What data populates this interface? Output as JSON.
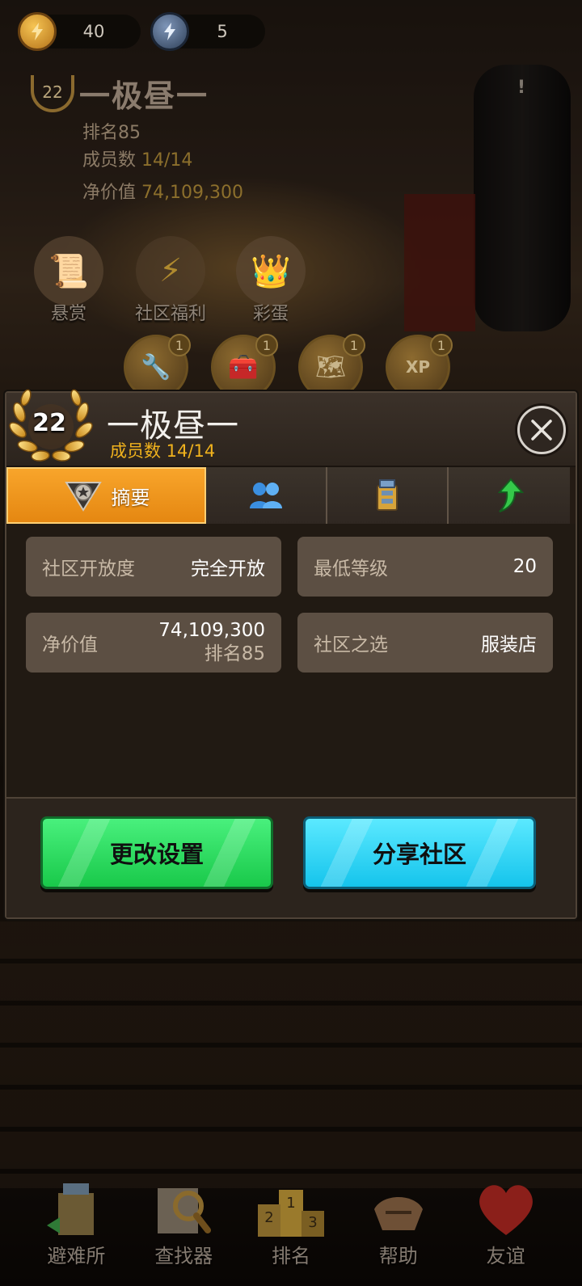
{
  "hud": {
    "coins": "40",
    "energy": "5"
  },
  "background_panel": {
    "level": "22",
    "name": "一极昼一",
    "rank_label": "排名",
    "rank_value": "85",
    "members_label": "成员数",
    "members_value": "14/14",
    "net_worth_label": "净价值",
    "net_worth_value": "74,109,300",
    "exclaim": "!"
  },
  "features": [
    {
      "label": "悬赏",
      "icon": "scroll-icon"
    },
    {
      "label": "社区福利",
      "icon": "lightning-icon"
    },
    {
      "label": "彩蛋",
      "icon": "crowned-egg-icon"
    }
  ],
  "rewards": [
    {
      "icon": "tools-icon",
      "badge": "1"
    },
    {
      "icon": "toolbox-icon",
      "badge": "1"
    },
    {
      "icon": "map-icon",
      "badge": "1"
    },
    {
      "icon": "xp-book-icon",
      "badge": "1"
    }
  ],
  "modal": {
    "level": "22",
    "title": "一极昼一",
    "members": "成员数 14/14",
    "tabs": [
      {
        "label": "摘要",
        "icon": "star-badge-icon",
        "active": true
      },
      {
        "label": "",
        "icon": "members-icon",
        "active": false
      },
      {
        "label": "",
        "icon": "shelter-tower-icon",
        "active": false
      },
      {
        "label": "",
        "icon": "upgrade-arrow-icon",
        "active": false
      }
    ],
    "cards": {
      "openness_label": "社区开放度",
      "openness_value": "完全开放",
      "min_level_label": "最低等级",
      "min_level_value": "20",
      "net_worth_label": "净价值",
      "net_worth_value": "74,109,300",
      "net_worth_rank": "排名85",
      "choice_label": "社区之选",
      "choice_value": "服装店"
    },
    "buttons": {
      "change_settings": "更改设置",
      "share": "分享社区"
    }
  },
  "bottom_nav": [
    {
      "label": "避难所",
      "icon": "shelter-icon"
    },
    {
      "label": "查找器",
      "icon": "magnifier-icon"
    },
    {
      "label": "排名",
      "icon": "podium-icon"
    },
    {
      "label": "帮助",
      "icon": "handshake-icon"
    },
    {
      "label": "友谊",
      "icon": "heart-icon"
    }
  ],
  "colors": {
    "accent_orange": "#f39a1e",
    "member_gold": "#f0b21d",
    "button_green": "#2fdc63",
    "button_cyan": "#2dd4f5"
  }
}
